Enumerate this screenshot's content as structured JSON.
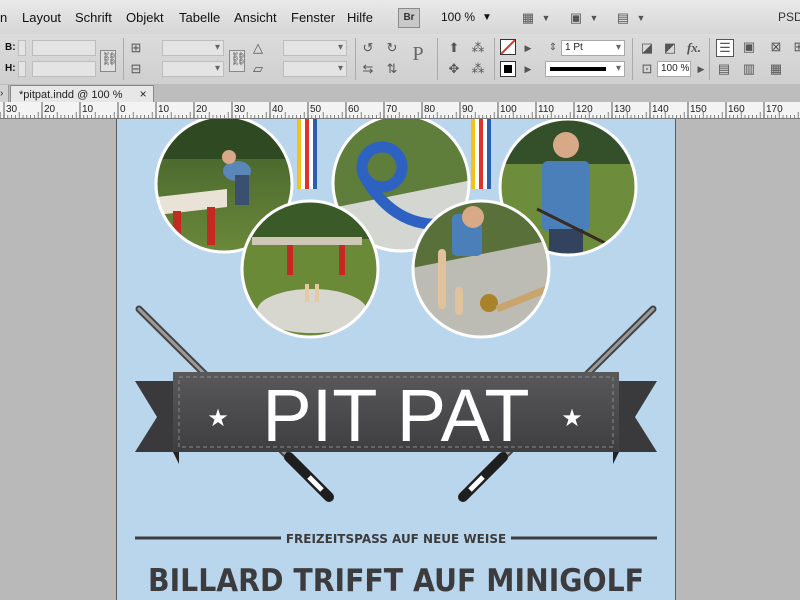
{
  "menu": {
    "items": [
      "n",
      "Layout",
      "Schrift",
      "Objekt",
      "Tabelle",
      "Ansicht",
      "Fenster",
      "Hilfe"
    ],
    "bridge_label": "Br",
    "zoom": "100 %",
    "right_label": "PSD"
  },
  "control": {
    "width_label": "B:",
    "height_label": "H:",
    "stroke_weight": "1 Pt",
    "opacity": "100 %",
    "proxy_letter": "P"
  },
  "tab": {
    "title": "*pitpat.indd @ 100 %",
    "close": "×"
  },
  "ruler": {
    "labels": [
      "30",
      "20",
      "10",
      "0",
      "10",
      "20",
      "30",
      "40",
      "50",
      "60",
      "70",
      "80",
      "90",
      "100",
      "110",
      "120",
      "130",
      "140",
      "150",
      "160",
      "170"
    ]
  },
  "poster": {
    "title": "PIT PAT",
    "star": "★",
    "tagline": "FREIZEITSPASS AUF NEUE WEISE",
    "headline": "BILLARD TRIFFT AUF MINIGOLF"
  },
  "colors": {
    "page_bg": "#bad6ed",
    "banner": "#4b4b4d",
    "stripe_red": "#e0322b",
    "stripe_blue": "#2a5fb0",
    "stripe_yellow": "#f2c21b",
    "text_dark": "#3c3c3e"
  }
}
